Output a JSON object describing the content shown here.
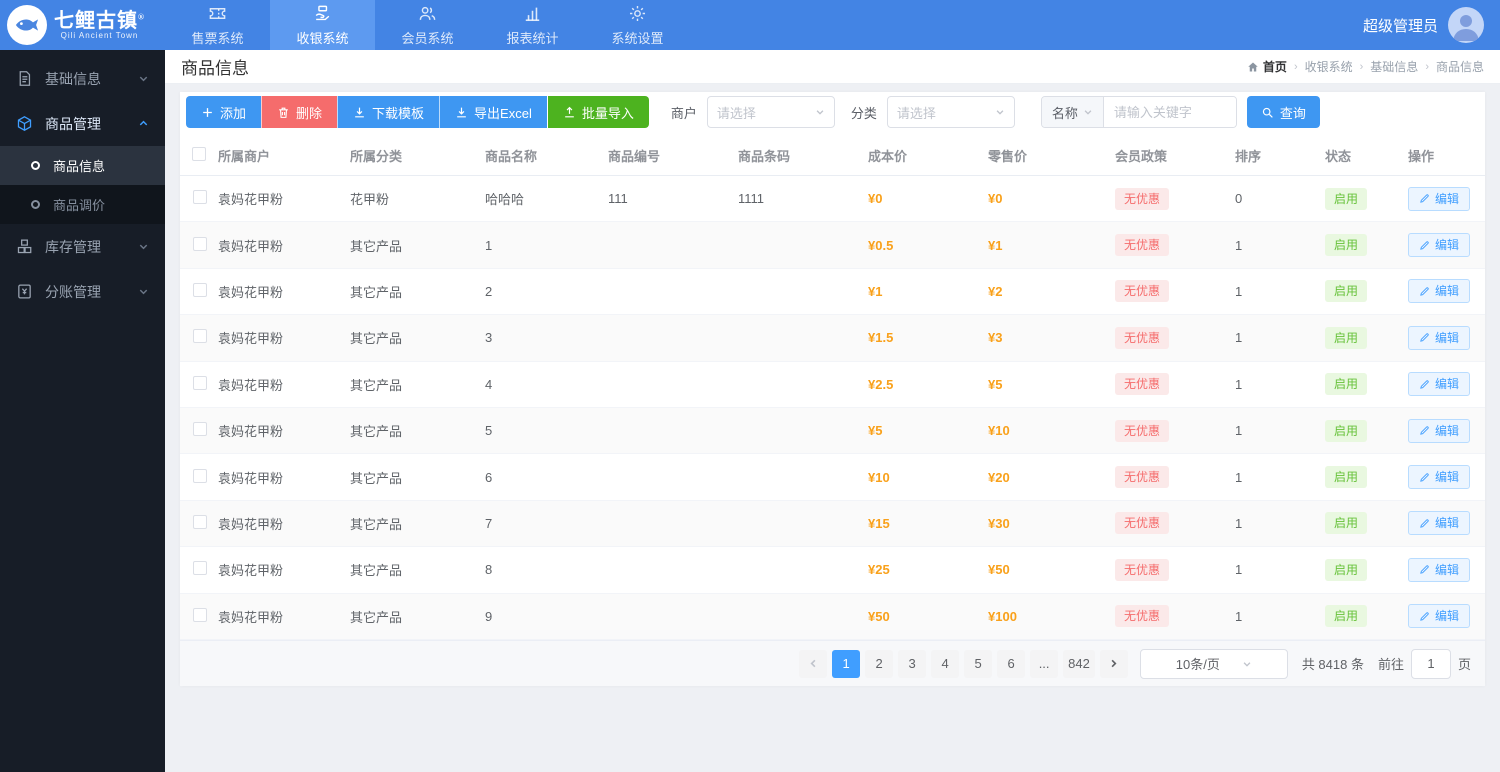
{
  "colors": {
    "navbar": "#4384e4",
    "accent": "#3e97f2",
    "danger": "#f56c6c",
    "success": "#4db31f",
    "price": "#f9a11b"
  },
  "navbar": {
    "logo": {
      "title": "七鲤古镇",
      "reg_mark": "®",
      "subtitle": "Qili Ancient Town"
    },
    "items": [
      {
        "label": "售票系统",
        "icon": "ticket-icon",
        "active": false
      },
      {
        "label": "收银系统",
        "icon": "pos-icon",
        "active": true
      },
      {
        "label": "会员系统",
        "icon": "members-icon",
        "active": false
      },
      {
        "label": "报表统计",
        "icon": "report-icon",
        "active": false
      },
      {
        "label": "系统设置",
        "icon": "gear-icon",
        "active": false
      }
    ],
    "user": {
      "name": "超级管理员"
    }
  },
  "sidebar": {
    "items": [
      {
        "label": "基础信息",
        "icon": "document-icon",
        "state": "collapsed"
      },
      {
        "label": "商品管理",
        "icon": "cube-icon",
        "state": "expanded",
        "children": [
          {
            "label": "商品信息",
            "active": true
          },
          {
            "label": "商品调价",
            "active": false
          }
        ]
      },
      {
        "label": "库存管理",
        "icon": "inventory-icon",
        "state": "collapsed"
      },
      {
        "label": "分账管理",
        "icon": "ledger-icon",
        "state": "collapsed"
      }
    ]
  },
  "page": {
    "title": "商品信息",
    "breadcrumb": {
      "home": "首页",
      "items": [
        "收银系统",
        "基础信息",
        "商品信息"
      ]
    }
  },
  "toolbar": {
    "add_label": "添加",
    "delete_label": "删除",
    "download_template_label": "下载模板",
    "export_excel_label": "导出Excel",
    "batch_import_label": "批量导入",
    "merchant_label": "商户",
    "merchant_placeholder": "请选择",
    "category_label": "分类",
    "category_placeholder": "请选择",
    "name_field_label": "名称",
    "keyword_placeholder": "请输入关键字",
    "search_label": "查询"
  },
  "table": {
    "columns": [
      "所属商户",
      "所属分类",
      "商品名称",
      "商品编号",
      "商品条码",
      "成本价",
      "零售价",
      "会员政策",
      "排序",
      "状态",
      "操作"
    ],
    "rows": [
      {
        "merchant": "袁妈花甲粉",
        "category": "花甲粉",
        "name": "哈哈哈",
        "code": "111",
        "barcode": "1111",
        "cost": "¥0",
        "retail": "¥0",
        "policy": "无优惠",
        "sort": "0",
        "status": "启用",
        "action": "编辑"
      },
      {
        "merchant": "袁妈花甲粉",
        "category": "其它产品",
        "name": "1",
        "code": "",
        "barcode": "",
        "cost": "¥0.5",
        "retail": "¥1",
        "policy": "无优惠",
        "sort": "1",
        "status": "启用",
        "action": "编辑"
      },
      {
        "merchant": "袁妈花甲粉",
        "category": "其它产品",
        "name": "2",
        "code": "",
        "barcode": "",
        "cost": "¥1",
        "retail": "¥2",
        "policy": "无优惠",
        "sort": "1",
        "status": "启用",
        "action": "编辑"
      },
      {
        "merchant": "袁妈花甲粉",
        "category": "其它产品",
        "name": "3",
        "code": "",
        "barcode": "",
        "cost": "¥1.5",
        "retail": "¥3",
        "policy": "无优惠",
        "sort": "1",
        "status": "启用",
        "action": "编辑"
      },
      {
        "merchant": "袁妈花甲粉",
        "category": "其它产品",
        "name": "4",
        "code": "",
        "barcode": "",
        "cost": "¥2.5",
        "retail": "¥5",
        "policy": "无优惠",
        "sort": "1",
        "status": "启用",
        "action": "编辑"
      },
      {
        "merchant": "袁妈花甲粉",
        "category": "其它产品",
        "name": "5",
        "code": "",
        "barcode": "",
        "cost": "¥5",
        "retail": "¥10",
        "policy": "无优惠",
        "sort": "1",
        "status": "启用",
        "action": "编辑"
      },
      {
        "merchant": "袁妈花甲粉",
        "category": "其它产品",
        "name": "6",
        "code": "",
        "barcode": "",
        "cost": "¥10",
        "retail": "¥20",
        "policy": "无优惠",
        "sort": "1",
        "status": "启用",
        "action": "编辑"
      },
      {
        "merchant": "袁妈花甲粉",
        "category": "其它产品",
        "name": "7",
        "code": "",
        "barcode": "",
        "cost": "¥15",
        "retail": "¥30",
        "policy": "无优惠",
        "sort": "1",
        "status": "启用",
        "action": "编辑"
      },
      {
        "merchant": "袁妈花甲粉",
        "category": "其它产品",
        "name": "8",
        "code": "",
        "barcode": "",
        "cost": "¥25",
        "retail": "¥50",
        "policy": "无优惠",
        "sort": "1",
        "status": "启用",
        "action": "编辑"
      },
      {
        "merchant": "袁妈花甲粉",
        "category": "其它产品",
        "name": "9",
        "code": "",
        "barcode": "",
        "cost": "¥50",
        "retail": "¥100",
        "policy": "无优惠",
        "sort": "1",
        "status": "启用",
        "action": "编辑"
      }
    ]
  },
  "pagination": {
    "pages": [
      "1",
      "2",
      "3",
      "4",
      "5",
      "6",
      "...",
      "842"
    ],
    "active": "1",
    "page_size": "10条/页",
    "total": "共 8418 条",
    "goto_prefix": "前往",
    "goto_value": "1",
    "goto_suffix": "页"
  }
}
